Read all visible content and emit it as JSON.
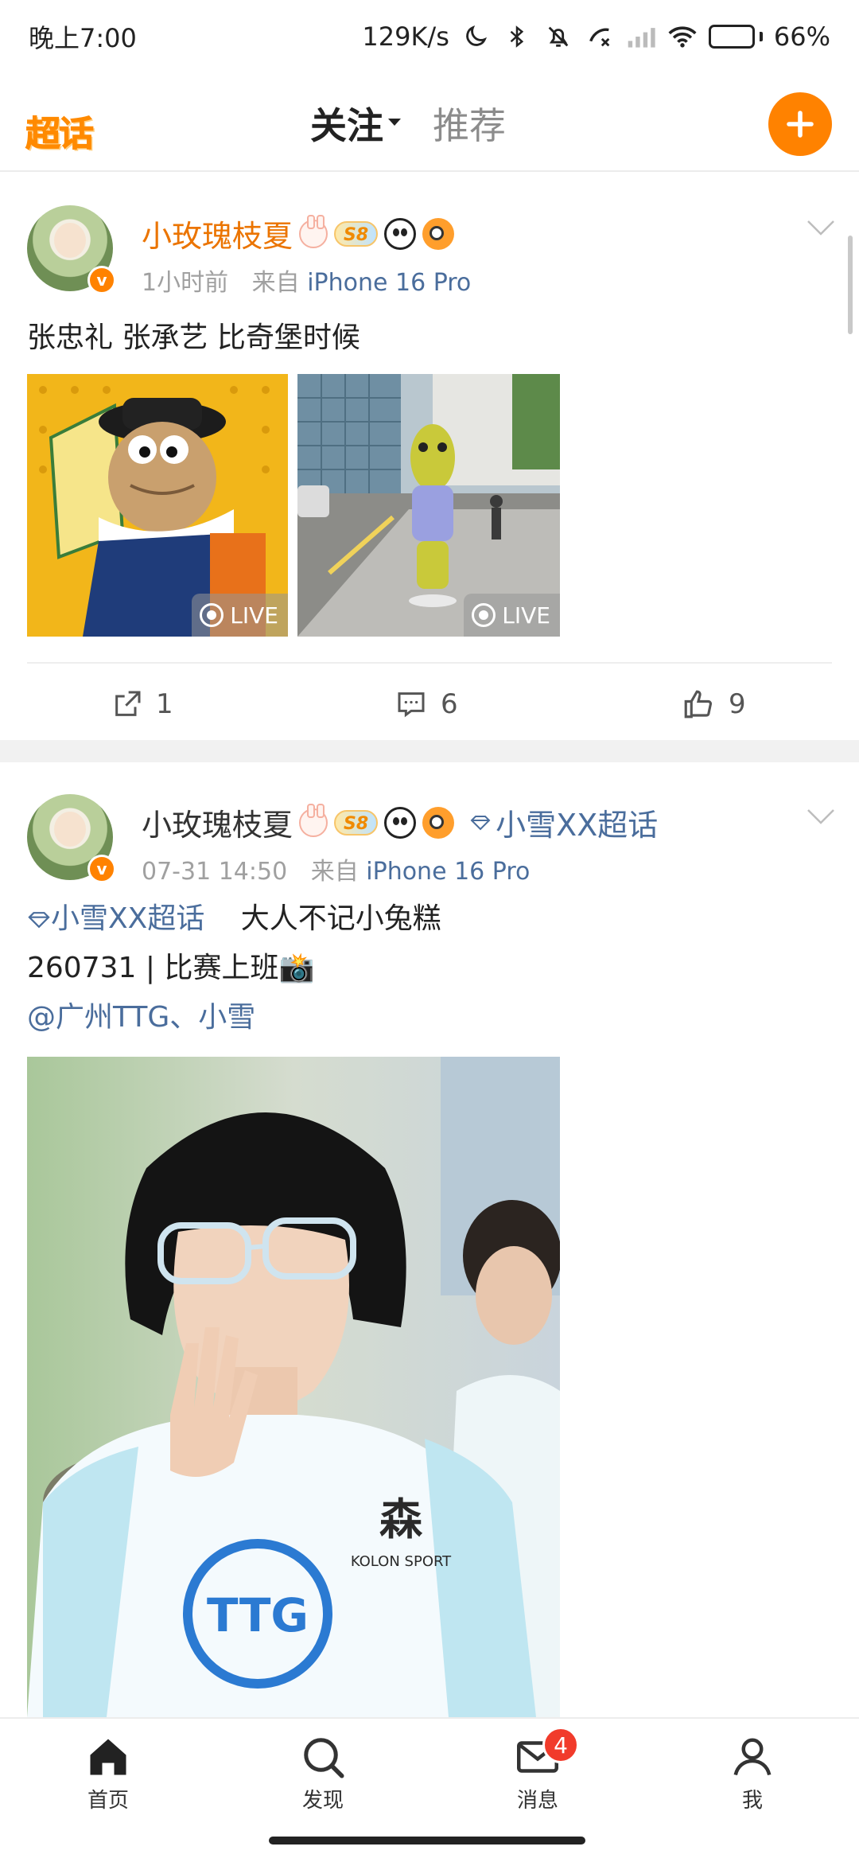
{
  "status_bar": {
    "time": "晚上7:00",
    "network_speed": "129K/s",
    "battery_percent": "66%",
    "battery_level": 0.66,
    "icons": [
      "moon-icon",
      "bluetooth-icon",
      "mute-bell-icon",
      "call-forward-icon",
      "signal-icon",
      "wifi-icon",
      "battery-icon"
    ]
  },
  "top_nav": {
    "logo_text": "超话",
    "tabs": [
      {
        "label": "关注",
        "active": true
      },
      {
        "label": "推荐",
        "active": false
      }
    ],
    "add_icon": "plus-icon"
  },
  "posts": [
    {
      "username": "小玫瑰枝夏",
      "level_badge": "S8",
      "time": "1小时前",
      "source_prefix": "来自",
      "source": "iPhone 16 Pro",
      "text_lines": [
        "张忠礼 张承艺 比奇堡时候"
      ],
      "images": [
        {
          "live_label": "LIVE"
        },
        {
          "live_label": "LIVE"
        }
      ],
      "actions": {
        "repost_count": "1",
        "comment_count": "6",
        "like_count": "9"
      }
    },
    {
      "username": "小玫瑰枝夏",
      "level_badge": "S8",
      "supertopic": "小雪XX超话",
      "time": "07-31 14:50",
      "source_prefix": "来自",
      "source": "iPhone 16 Pro",
      "text_topic": "小雪XX超话",
      "text_line1_rest": "大人不记小兔糕",
      "text_line2": "260731 | 比赛上班📸",
      "text_mention": "@广州TTG、小雪"
    }
  ],
  "bottom_nav": {
    "items": [
      {
        "label": "首页",
        "icon": "home-icon"
      },
      {
        "label": "发现",
        "icon": "search-icon"
      },
      {
        "label": "消息",
        "icon": "mail-icon",
        "badge": "4"
      },
      {
        "label": "我",
        "icon": "person-icon"
      }
    ]
  },
  "colors": {
    "brand_orange": "#ff8200",
    "username_orange": "#eb7400",
    "link_blue": "#4a6d9c",
    "tab_underline": "#ffae00",
    "badge_red": "#f13b2b"
  }
}
